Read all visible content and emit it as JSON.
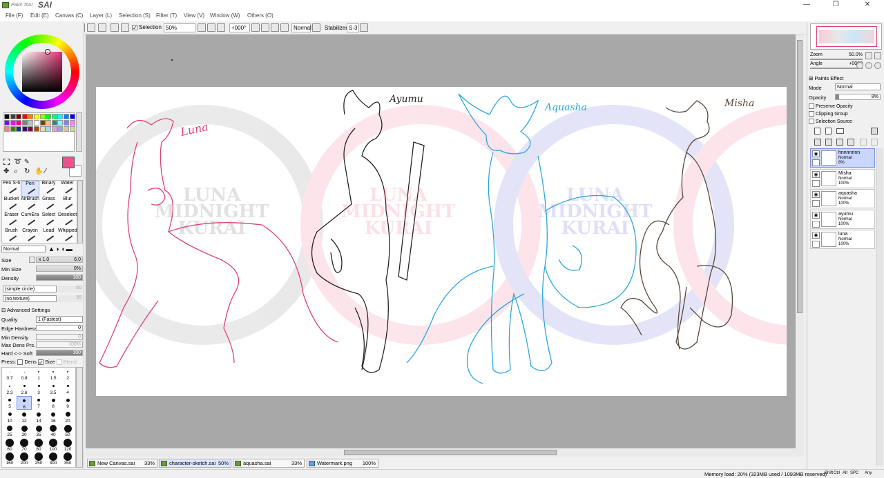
{
  "app": {
    "logo_small": "Paint Tool",
    "logo_big": "SAI"
  },
  "window_controls": [
    "—",
    "❐",
    "✕"
  ],
  "menu": [
    "File (F)",
    "Edit (E)",
    "Canvas (C)",
    "Layer (L)",
    "Selection (S)",
    "Filter (T)",
    "View (V)",
    "Window (W)",
    "Others (O)"
  ],
  "toolbar": {
    "selection_label": "Selection",
    "zoom": "50%",
    "angle": "+000°",
    "mode": "Normal",
    "stabilizer_label": "Stabilizer",
    "stabilizer_value": "S-3"
  },
  "colors": {
    "primary": "#f0508c",
    "secondary": "#ffffff",
    "palette": [
      "#000000",
      "#404040",
      "#800000",
      "#ff0000",
      "#ff8000",
      "#ffff00",
      "#80ff00",
      "#00ff00",
      "#00ff80",
      "#00ffff",
      "#0080ff",
      "#0000ff",
      "#8000ff",
      "#ff00ff",
      "#ff0080",
      "#808080",
      "#c0c0c0",
      "#ffffff",
      "#804000",
      "#ffc080",
      "#408080",
      "#80ffff",
      "#8080ff",
      "#ff80ff",
      "#ff8080",
      "#408000",
      "#004080",
      "#400080",
      "#800040",
      "#c04000",
      "#e0e0a0",
      "#a0e0e0",
      "#e0a0e0",
      "#a0a0e0",
      "#e0c0a0",
      "#c0e0a0"
    ]
  },
  "tools": [
    {
      "label": "Pen S-6"
    },
    {
      "label": "Pen"
    },
    {
      "label": "Binary"
    },
    {
      "label": "Water"
    },
    {
      "label": "Bucket"
    },
    {
      "label": "AirBrush"
    },
    {
      "label": "Grass"
    },
    {
      "label": "Blur"
    },
    {
      "label": "Eraser"
    },
    {
      "label": "CurvEra"
    },
    {
      "label": "Select"
    },
    {
      "label": "Deselect"
    },
    {
      "label": "Brush"
    },
    {
      "label": "Crayon"
    },
    {
      "label": "Lead"
    },
    {
      "label": "Whipped"
    }
  ],
  "brush": {
    "blend_mode": "Normal",
    "size_label": "Size",
    "size_multiplier": "x 1.0",
    "size_value": "6.0",
    "min_size_label": "Min Size",
    "min_size_value": "0%",
    "density_label": "Density",
    "density_value": "100",
    "shape": "(simple circle)",
    "shape_value": "50",
    "texture": "(no texture)",
    "texture_value": "95",
    "advanced_label": "Advanced Settings",
    "quality_label": "Quality",
    "quality_value": "1 (Fastest)",
    "edge_label": "Edge Hardness",
    "edge_value": "0",
    "min_density_label": "Min Density",
    "min_density_value": "0",
    "max_dens_label": "Max Dens Prs.",
    "max_dens_value": "100%",
    "hard_soft_label": "Hard <-> Soft",
    "hard_soft_value": "100",
    "press_label": "Press:",
    "press_dens": "Dens",
    "press_size": "Size",
    "press_blend": "Blend"
  },
  "brush_sizes": [
    "0.7",
    "0.8",
    "1",
    "1.5",
    "2",
    "2.3",
    "2.6",
    "3",
    "3.5",
    "4",
    "5",
    "6",
    "7",
    "8",
    "9",
    "10",
    "12",
    "14",
    "16",
    "20",
    "25",
    "30",
    "35",
    "40",
    "50",
    "60",
    "70",
    "80",
    "100",
    "120",
    "160",
    "200",
    "250",
    "300",
    "350"
  ],
  "canvas": {
    "names": [
      "Luna",
      "Ayumu",
      "Aquasha",
      "Misha"
    ],
    "watermark_line1": "LUNA",
    "watermark_line2": "MIDNIGHT",
    "watermark_line3": "KURAI"
  },
  "doc_tabs": [
    {
      "name": "New Canvas.sai",
      "zoom": "33%"
    },
    {
      "name": "character-sketch.sai",
      "zoom": "50%"
    },
    {
      "name": "aquasha.sai",
      "zoom": "33%"
    },
    {
      "name": "Watermark.png",
      "zoom": "100%"
    }
  ],
  "navigator": {
    "zoom_label": "Zoom",
    "zoom_value": "50.0%",
    "angle_label": "Angle",
    "angle_value": "+0000"
  },
  "layer_props": {
    "paints_effect": "Paints Effect",
    "mode_label": "Mode",
    "mode_value": "Normal",
    "opacity_label": "Opacity",
    "opacity_value": "8%",
    "preserve_opacity": "Preserve Opacity",
    "clipping_group": "Clipping Group",
    "selection_source": "Selection Source"
  },
  "layers": [
    {
      "name": "hnnnnnnn",
      "mode": "Normal",
      "opacity": "8%"
    },
    {
      "name": "Misha",
      "mode": "Normal",
      "opacity": "100%"
    },
    {
      "name": "aquasha",
      "mode": "Normal",
      "opacity": "100%"
    },
    {
      "name": "ayumu",
      "mode": "Normal",
      "opacity": "100%"
    },
    {
      "name": "luna",
      "mode": "Normal",
      "opacity": "100%"
    }
  ],
  "status": {
    "memory": "Memory load: 20% (323MB used / 1093MB reserved)",
    "keys": [
      "Shift",
      "Ctrl",
      "Alt",
      "SPC",
      "Any"
    ]
  }
}
